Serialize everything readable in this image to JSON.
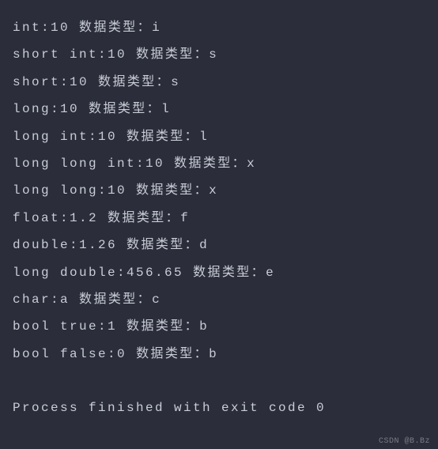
{
  "lines": [
    {
      "prefix": "int:",
      "value": "10",
      "label": "数据类型：",
      "typecode": "i"
    },
    {
      "prefix": "short int:",
      "value": "10",
      "label": "数据类型：",
      "typecode": "s"
    },
    {
      "prefix": "short:",
      "value": "10",
      "label": "数据类型：",
      "typecode": "s"
    },
    {
      "prefix": "long:",
      "value": "10",
      "label": "数据类型：",
      "typecode": "l"
    },
    {
      "prefix": "long int:",
      "value": "10",
      "label": "数据类型：",
      "typecode": "l"
    },
    {
      "prefix": "long long int:",
      "value": "10",
      "label": "数据类型：",
      "typecode": "x"
    },
    {
      "prefix": "long long:",
      "value": "10",
      "label": "数据类型：",
      "typecode": "x"
    },
    {
      "prefix": "float:",
      "value": "1.2",
      "label": "数据类型：",
      "typecode": "f"
    },
    {
      "prefix": "double:",
      "value": "1.26",
      "label": "数据类型：",
      "typecode": "d"
    },
    {
      "prefix": "long double:",
      "value": "456.65",
      "label": "数据类型：",
      "typecode": "e"
    },
    {
      "prefix": "char:",
      "value": "a",
      "label": "数据类型：",
      "typecode": "c"
    },
    {
      "prefix": "bool true:",
      "value": "1",
      "label": "数据类型：",
      "typecode": "b"
    },
    {
      "prefix": "bool false:",
      "value": "0",
      "label": "数据类型：",
      "typecode": "b"
    }
  ],
  "exit_message": "Process finished with exit code 0",
  "watermark": "CSDN @B.Bz"
}
